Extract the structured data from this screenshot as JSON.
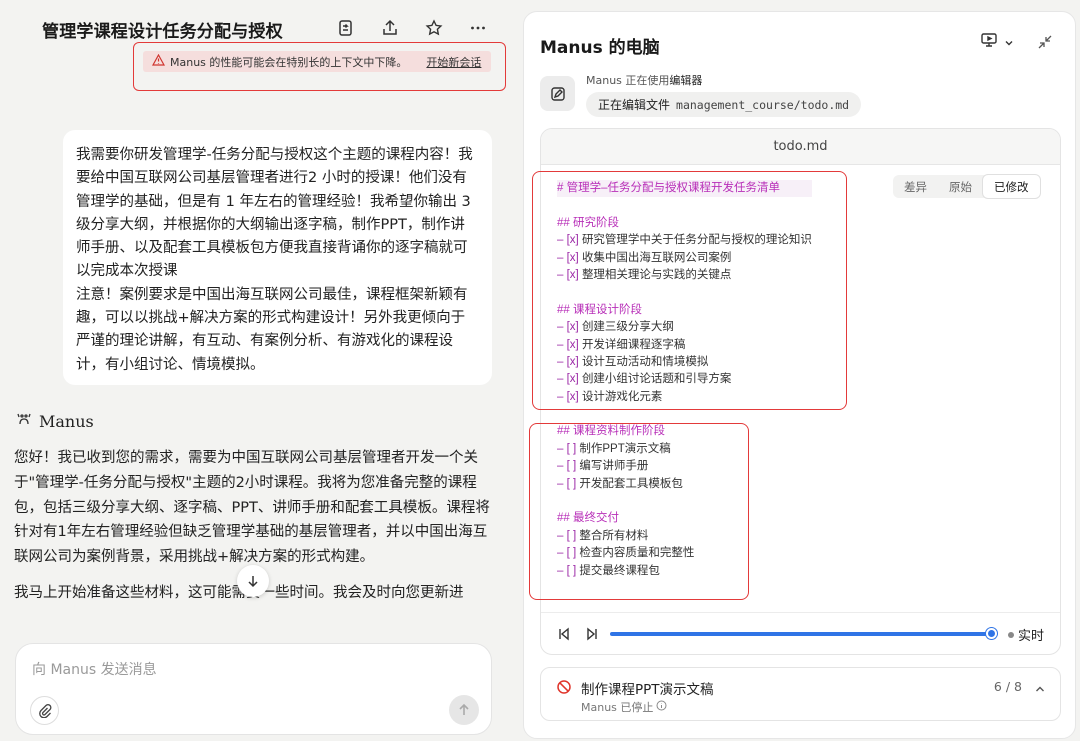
{
  "left": {
    "title": "管理学课程设计任务分配与授权",
    "warning_text": "Manus 的性能可能会在特别长的上下文中下降。",
    "warning_link": "开始新会话",
    "user_message": [
      "我需要你研发管理学-任务分配与授权这个主题的课程内容！我要给中国互联网公司基层管理者进行2 小时的授课！他们没有管理学的基础，但是有 1 年左右的管理经验！我希望你输出 3 级分享大纲，并根据你的大纲输出逐字稿，制作PPT，制作讲师手册、以及配套工具模板包方便我直接背诵你的逐字稿就可以完成本次授课",
      "注意！案例要求是中国出海互联网公司最佳，课程框架新颖有趣，可以以挑战+解决方案的形式构建设计！另外我更倾向于严谨的理论讲解，有互动、有案例分析、有游戏化的课程设计，有小组讨论、情境模拟。"
    ],
    "assistant_name": "Manus",
    "reply": [
      "您好！我已收到您的需求，需要为中国互联网公司基层管理者开发一个关于\"管理学-任务分配与授权\"主题的2小时课程。我将为您准备完整的课程包，包括三级分享大纲、逐字稿、PPT、讲师手册和配套工具模板。课程将针对有1年左右管理经验但缺乏管理学基础的基层管理者，并以中国出海互联网公司为案例背景，采用挑战+解决方案的形式构建。",
      "我马上开始准备这些材料，这可能需要一些时间。我会及时向您更新进"
    ],
    "composer_placeholder": "向 Manus 发送消息"
  },
  "right": {
    "title": "Manus 的电脑",
    "status_prefix": "Manus 正在使用",
    "status_tool": "编辑器",
    "pill_label": "正在编辑文件",
    "pill_path": "management_course/todo.md",
    "file_name": "todo.md",
    "view_tabs": [
      "差异",
      "原始",
      "已修改"
    ],
    "active_tab": "已修改",
    "lines": [
      {
        "k": "h1",
        "text": "管理学–任务分配与授权课程开发任务清单"
      },
      {
        "k": "blank",
        "text": ""
      },
      {
        "k": "h2",
        "text": "研究阶段"
      },
      {
        "k": "done",
        "text": "研究管理学中关于任务分配与授权的理论知识"
      },
      {
        "k": "done",
        "text": "收集中国出海互联网公司案例"
      },
      {
        "k": "done",
        "text": "整理相关理论与实践的关键点"
      },
      {
        "k": "blank",
        "text": ""
      },
      {
        "k": "h2",
        "text": "课程设计阶段"
      },
      {
        "k": "done",
        "text": "创建三级分享大纲"
      },
      {
        "k": "done",
        "text": "开发详细课程逐字稿"
      },
      {
        "k": "done",
        "text": "设计互动活动和情境模拟"
      },
      {
        "k": "done",
        "text": "创建小组讨论话题和引导方案"
      },
      {
        "k": "done",
        "text": "设计游戏化元素"
      },
      {
        "k": "blank",
        "text": ""
      },
      {
        "k": "h2",
        "text": "课程资料制作阶段"
      },
      {
        "k": "todo",
        "text": "制作PPT演示文稿"
      },
      {
        "k": "todo",
        "text": "编写讲师手册"
      },
      {
        "k": "todo",
        "text": "开发配套工具模板包"
      },
      {
        "k": "blank",
        "text": ""
      },
      {
        "k": "h2",
        "text": "最终交付"
      },
      {
        "k": "todo",
        "text": "整合所有材料"
      },
      {
        "k": "todo",
        "text": "检查内容质量和完整性"
      },
      {
        "k": "todo",
        "text": "提交最终课程包"
      }
    ],
    "live_label": "实时",
    "progress": 0.99,
    "task_name": "制作课程PPT演示文稿",
    "task_sub": "Manus 已停止",
    "task_count": "6 / 8"
  }
}
